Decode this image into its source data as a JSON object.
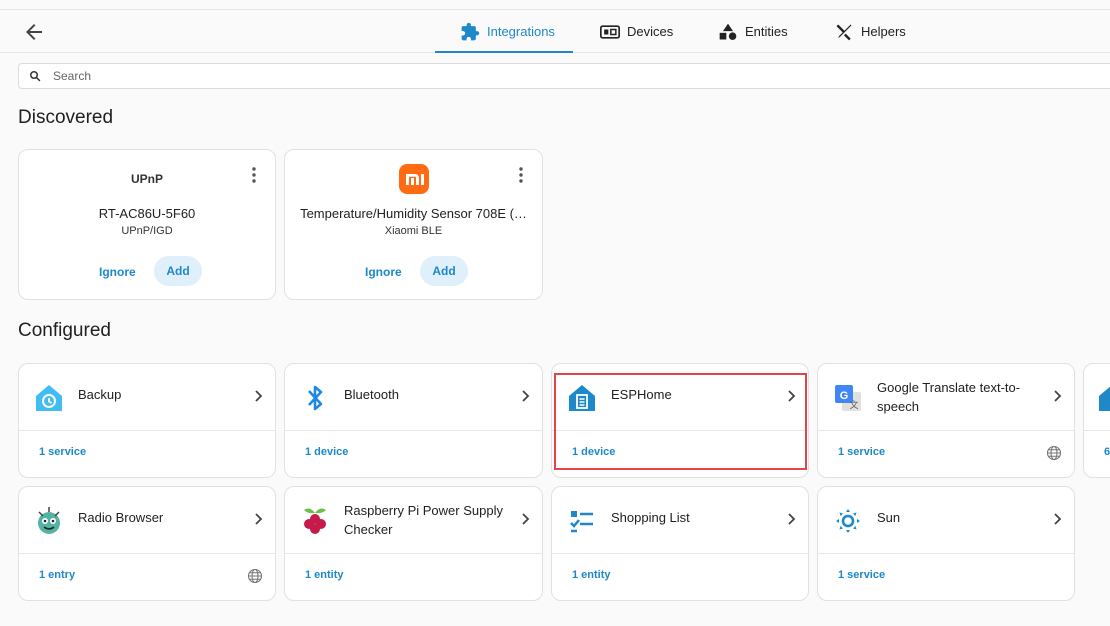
{
  "nav": {
    "tabs": [
      {
        "label": "Integrations",
        "active": true
      },
      {
        "label": "Devices"
      },
      {
        "label": "Entities"
      },
      {
        "label": "Helpers"
      }
    ]
  },
  "search": {
    "placeholder": "Search"
  },
  "discovered": {
    "title": "Discovered",
    "cards": [
      {
        "logo_text": "UPnP",
        "name": "RT-AC86U-5F60",
        "integration": "UPnP/IGD",
        "ignore_label": "Ignore",
        "add_label": "Add"
      },
      {
        "logo_text": "mi",
        "name": "Temperature/Humidity Sensor 708E (…",
        "integration": "Xiaomi BLE",
        "ignore_label": "Ignore",
        "add_label": "Add"
      }
    ]
  },
  "configured": {
    "title": "Configured",
    "cards": [
      {
        "title": "Backup",
        "footer": "1 service",
        "icon": "backup-icon"
      },
      {
        "title": "Bluetooth",
        "footer": "1 device",
        "icon": "bluetooth-icon"
      },
      {
        "title": "ESPHome",
        "footer": "1 device",
        "icon": "esphome-icon"
      },
      {
        "title": "Google Translate text-to-speech",
        "footer": "1 service",
        "icon": "google-translate-icon"
      },
      {
        "title": "",
        "footer": "6",
        "icon": "partial-integration-icon"
      },
      {
        "title": "Radio Browser",
        "footer": "1 entry",
        "icon": "radio-browser-icon"
      },
      {
        "title": "Raspberry Pi Power Supply Checker",
        "footer": "1 entity",
        "icon": "raspberry-pi-icon"
      },
      {
        "title": "Shopping List",
        "footer": "1 entity",
        "icon": "shopping-list-icon"
      },
      {
        "title": "Sun",
        "footer": "1 service",
        "icon": "sun-icon"
      }
    ]
  },
  "colors": {
    "accent": "#1e88c9",
    "highlight": "#e0454a"
  }
}
